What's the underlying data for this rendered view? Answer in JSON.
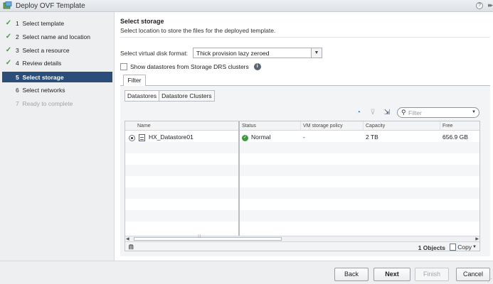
{
  "window": {
    "title": "Deploy OVF Template",
    "help_label": "?",
    "expand_label": "▸▸"
  },
  "steps": [
    {
      "number": "1",
      "label": "Select template",
      "state": "done"
    },
    {
      "number": "2",
      "label": "Select name and location",
      "state": "done"
    },
    {
      "number": "3",
      "label": "Select a resource",
      "state": "done"
    },
    {
      "number": "4",
      "label": "Review details",
      "state": "done"
    },
    {
      "number": "5",
      "label": "Select storage",
      "state": "active"
    },
    {
      "number": "6",
      "label": "Select networks",
      "state": "pending"
    },
    {
      "number": "7",
      "label": "Ready to complete",
      "state": "disabled"
    }
  ],
  "main": {
    "heading": "Select storage",
    "subheading": "Select location to store the files for the deployed template.",
    "disk_format_label": "Select virtual disk format:",
    "disk_format_value": "Thick provision lazy zeroed",
    "sdrs_label": "Show datastores from Storage DRS clusters",
    "filter_tab": "Filter",
    "subtabs": [
      "Datastores",
      "Datastore Clusters"
    ],
    "filter_placeholder": "Filter"
  },
  "grid": {
    "columns": [
      "Name",
      "Status",
      "VM storage policy",
      "Capacity",
      "Free"
    ],
    "rows": [
      {
        "name": "HX_Datastore01",
        "status": "Normal",
        "policy": "-",
        "capacity": "2 TB",
        "free": "656.9 GB"
      }
    ],
    "object_count": "1 Objects",
    "copy_label": "Copy"
  },
  "buttons": {
    "back": "Back",
    "next": "Next",
    "finish": "Finish",
    "cancel": "Cancel"
  },
  "icons": {
    "status_ok": "check-circle",
    "info": "info-circle",
    "refresh": "refresh-icon",
    "filter_clear": "filter-clear-icon",
    "export": "export-icon",
    "search": "search-icon",
    "binoculars": "binoculars-icon"
  },
  "colors": {
    "active_step_bg": "#2a4e79",
    "ok_green": "#3f9a3f"
  }
}
